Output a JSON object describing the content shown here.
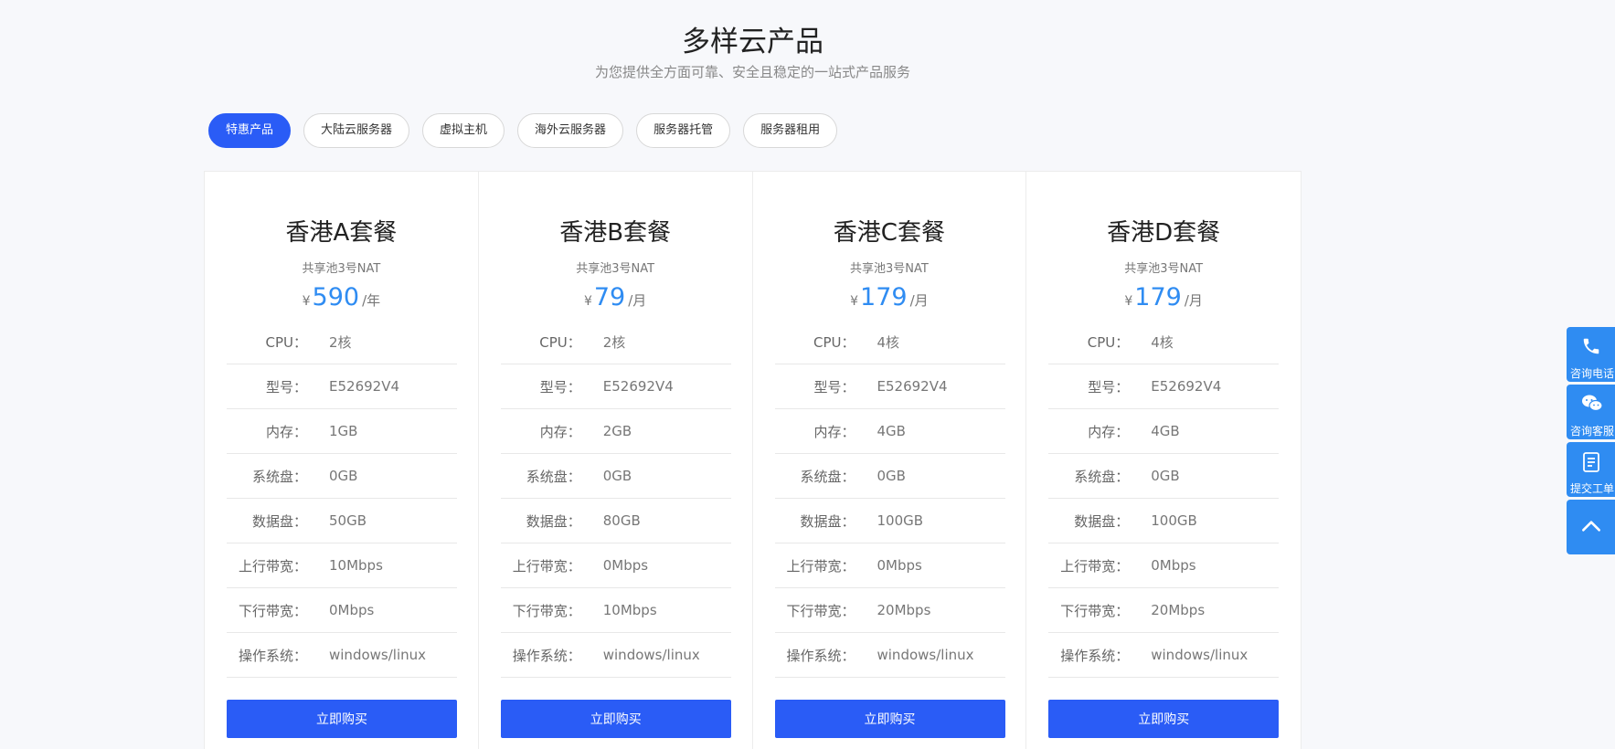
{
  "header": {
    "title": "多样云产品",
    "subtitle": "为您提供全方面可靠、安全且稳定的一站式产品服务"
  },
  "tabs": [
    {
      "label": "特惠产品",
      "active": true
    },
    {
      "label": "大陆云服务器",
      "active": false
    },
    {
      "label": "虚拟主机",
      "active": false
    },
    {
      "label": "海外云服务器",
      "active": false
    },
    {
      "label": "服务器托管",
      "active": false
    },
    {
      "label": "服务器租用",
      "active": false
    }
  ],
  "spec_labels": {
    "cpu": "CPU：",
    "model": "型号：",
    "memory": "内存：",
    "sysdisk": "系统盘：",
    "datadisk": "数据盘：",
    "up": "上行带宽：",
    "down": "下行带宽：",
    "os": "操作系统："
  },
  "currency": "¥",
  "cards": [
    {
      "name": "香港A套餐",
      "pool": "共享池3号NAT",
      "price": "590",
      "unit": "/年",
      "cpu": "2核",
      "model": "E52692V4",
      "memory": "1GB",
      "sysdisk": "0GB",
      "datadisk": "50GB",
      "up": "10Mbps",
      "down": "0Mbps",
      "os": "windows/linux",
      "buy_label": "立即购买"
    },
    {
      "name": "香港B套餐",
      "pool": "共享池3号NAT",
      "price": "79",
      "unit": "/月",
      "cpu": "2核",
      "model": "E52692V4",
      "memory": "2GB",
      "sysdisk": "0GB",
      "datadisk": "80GB",
      "up": "0Mbps",
      "down": "10Mbps",
      "os": "windows/linux",
      "buy_label": "立即购买"
    },
    {
      "name": "香港C套餐",
      "pool": "共享池3号NAT",
      "price": "179",
      "unit": "/月",
      "cpu": "4核",
      "model": "E52692V4",
      "memory": "4GB",
      "sysdisk": "0GB",
      "datadisk": "100GB",
      "up": "0Mbps",
      "down": "20Mbps",
      "os": "windows/linux",
      "buy_label": "立即购买"
    },
    {
      "name": "香港D套餐",
      "pool": "共享池3号NAT",
      "price": "179",
      "unit": "/月",
      "cpu": "4核",
      "model": "E52692V4",
      "memory": "4GB",
      "sysdisk": "0GB",
      "datadisk": "100GB",
      "up": "0Mbps",
      "down": "20Mbps",
      "os": "windows/linux",
      "buy_label": "立即购买"
    }
  ],
  "side": {
    "phone": "咨询电话",
    "wechat": "咨询客服",
    "ticket": "提交工单"
  },
  "colors": {
    "accent": "#2a5cf6",
    "price": "#2f8cf2",
    "side": "#2f8cf2"
  }
}
